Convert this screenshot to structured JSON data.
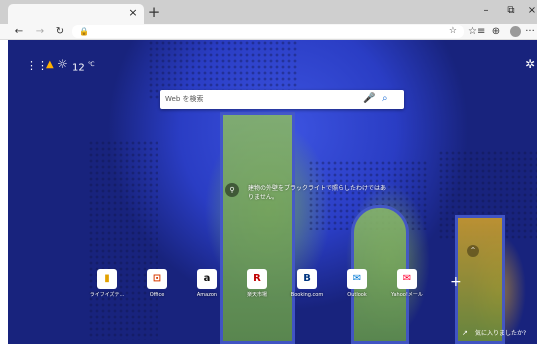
{
  "tab": {
    "close": "×",
    "new_tab": "+"
  },
  "window": {
    "minimize": "–",
    "maximize": "⧉",
    "close": "×"
  },
  "toolbar": {
    "back": "←",
    "forward": "→",
    "refresh": "↻",
    "lock": "🔒",
    "star": "☆",
    "reading": "☆≡",
    "collections": "⊕",
    "more": "···"
  },
  "weather": {
    "warn": "▲",
    "sun": "☼",
    "temp": "12",
    "unit": "℃"
  },
  "icons": {
    "apps": "⋮⋮",
    "settings": "✲",
    "mic": "🎤",
    "search": "⌕",
    "info": "⚲",
    "up": "^",
    "add": "+"
  },
  "search": {
    "placeholder": "Web を検索"
  },
  "image": {
    "caption": "建物の外壁をブラックライトで照らしたわけではありません。"
  },
  "tiles": [
    {
      "label": "ライフイズテ...",
      "glyph": "▮",
      "color": "#e2a100"
    },
    {
      "label": "Office",
      "glyph": "⊡",
      "color": "#d83b01"
    },
    {
      "label": "Amazon",
      "glyph": "a",
      "color": "#111111"
    },
    {
      "label": "楽天市場",
      "glyph": "R",
      "color": "#bf0000"
    },
    {
      "label": "Booking.com",
      "glyph": "B",
      "color": "#003580"
    },
    {
      "label": "Outlook",
      "glyph": "✉",
      "color": "#0078d4"
    },
    {
      "label": "Yahoo!メール",
      "glyph": "✉",
      "color": "#ff0033"
    }
  ],
  "footer": {
    "fav_icon": "↗",
    "fav_text": "気に入りましたか?"
  }
}
